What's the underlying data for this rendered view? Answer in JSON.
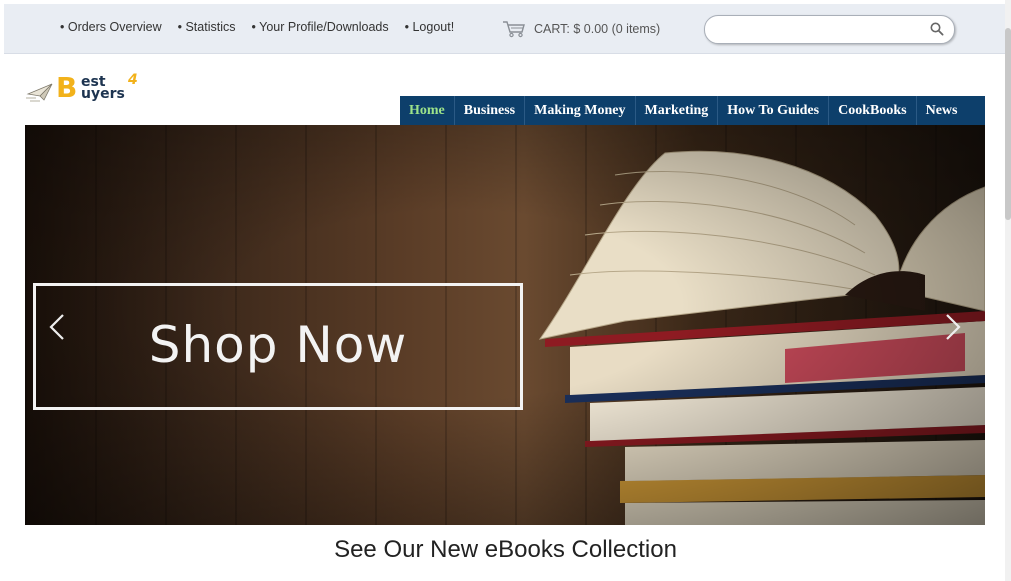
{
  "topbar": {
    "links": [
      "• Orders Overview",
      "• Statistics",
      "• Your Profile/Downloads",
      "• Logout!"
    ],
    "cart_label": "CART: $ 0.00 (0 items)",
    "cart_icon": "cart-icon",
    "search_placeholder": "",
    "search_icon": "search-icon"
  },
  "logo": {
    "big_letter": "B",
    "line1": "est",
    "line2": "uyers",
    "suffix": "4"
  },
  "nav": {
    "items": [
      "Home",
      "Business",
      "Making Money",
      "Marketing",
      "How To Guides",
      "CookBooks",
      "News"
    ],
    "active_index": 0,
    "active_color": "#9de38a",
    "bg_color": "#0d3f6b"
  },
  "hero": {
    "cta": "Shop Now",
    "prev_icon": "chevron-left-icon",
    "next_icon": "chevron-right-icon"
  },
  "headline": "See Our New eBooks Collection"
}
